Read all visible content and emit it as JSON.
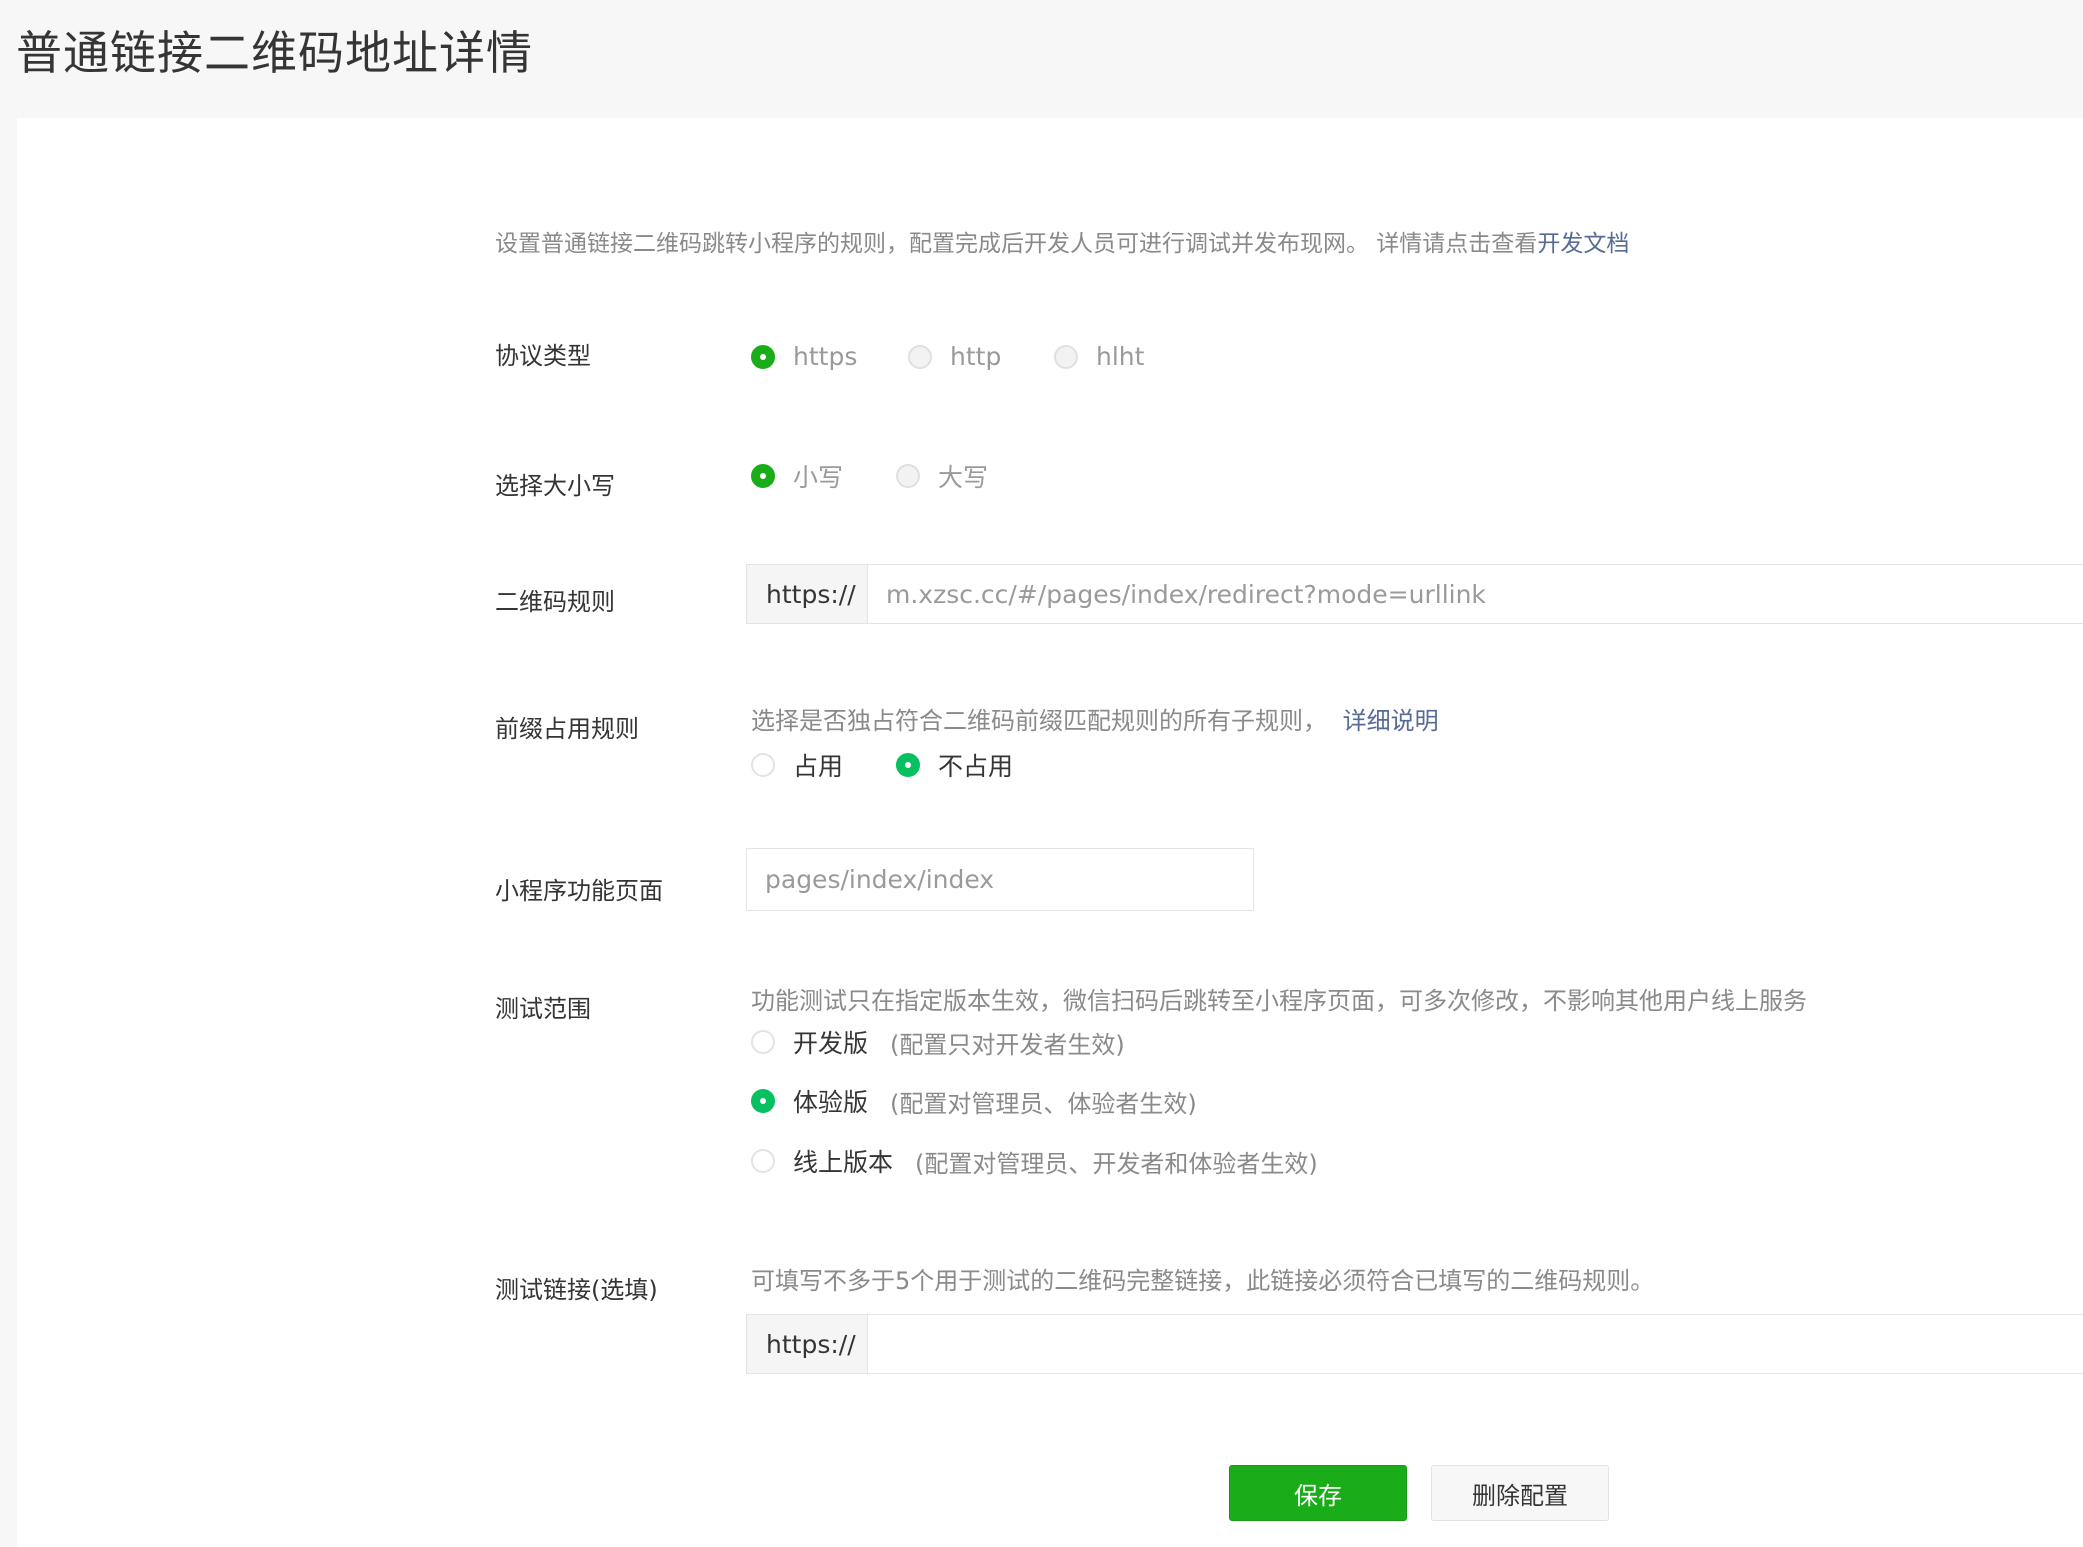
{
  "page": {
    "title": "普通链接二维码地址详情"
  },
  "intro": {
    "text": "设置普通链接二维码跳转小程序的规则，配置完成后开发人员可进行调试并发布现网。 详情请点击查看",
    "link": "开发文档"
  },
  "protocol": {
    "label": "协议类型",
    "options": [
      "https",
      "http",
      "hlht"
    ],
    "selected": "https"
  },
  "case": {
    "label": "选择大小写",
    "options": [
      "小写",
      "大写"
    ],
    "selected": "小写"
  },
  "qr_rule": {
    "label": "二维码规则",
    "prefix": "https://",
    "value": "m.xzsc.cc/#/pages/index/redirect?mode=urllink"
  },
  "prefix_rule": {
    "label": "前缀占用规则",
    "description": "选择是否独占符合二维码前缀匹配规则的所有子规则，",
    "link": "详细说明",
    "options": [
      "占用",
      "不占用"
    ],
    "selected": "不占用"
  },
  "page_path": {
    "label": "小程序功能页面",
    "placeholder": "pages/index/index"
  },
  "test_scope": {
    "label": "测试范围",
    "description": "功能测试只在指定版本生效，微信扫码后跳转至小程序页面，可多次修改，不影响其他用户线上服务",
    "options": [
      {
        "label": "开发版",
        "hint": "(配置只对开发者生效)"
      },
      {
        "label": "体验版",
        "hint": "(配置对管理员、体验者生效)"
      },
      {
        "label": "线上版本",
        "hint": "(配置对管理员、开发者和体验者生效)"
      }
    ],
    "selected": "体验版"
  },
  "test_link": {
    "label": "测试链接(选填)",
    "description": "可填写不多于5个用于测试的二维码完整链接，此链接必须符合已填写的二维码规则。",
    "prefix": "https://",
    "value": ""
  },
  "actions": {
    "save": "保存",
    "delete": "删除配置"
  },
  "colors": {
    "primary": "#1aad19",
    "link": "#576b95"
  }
}
